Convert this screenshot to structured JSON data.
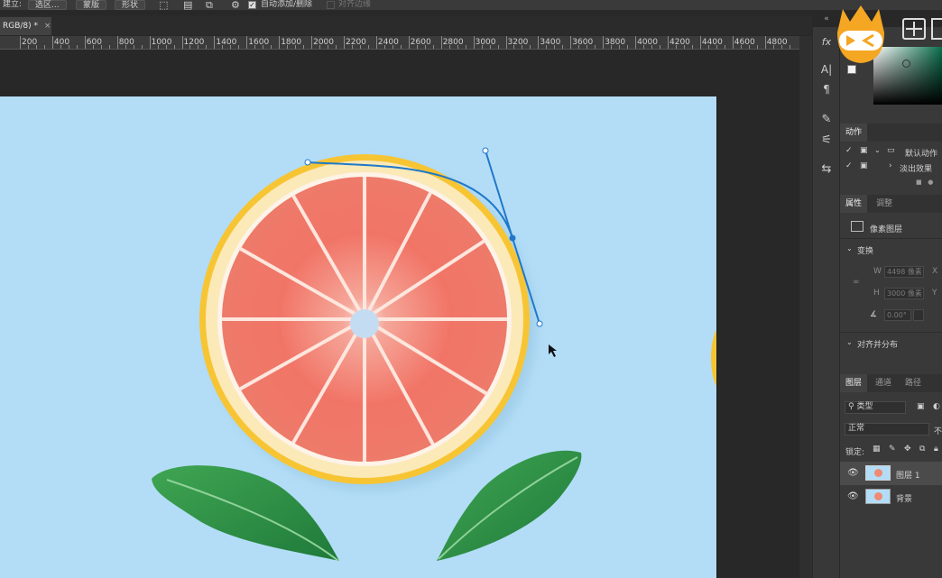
{
  "options_bar": {
    "create_label": "建立:",
    "selection_btn": "选区...",
    "mask_btn": "蒙版",
    "shape_btn": "形状",
    "auto_add_delete": "自动添加/删除",
    "align_edges": "对齐边缘"
  },
  "document": {
    "tab_title": "RGB/8) *",
    "close_glyph": "×"
  },
  "ruler": {
    "labels": [
      "200",
      "400",
      "600",
      "800",
      "1000",
      "1200",
      "1400",
      "1600",
      "1800",
      "2000",
      "2200",
      "2400",
      "2600",
      "2800",
      "3000",
      "3200",
      "3400",
      "3600",
      "3800",
      "4000",
      "4200",
      "4400",
      "4600",
      "4800"
    ]
  },
  "toolstrip": {
    "collapse_glyph": "«",
    "fx": "fx",
    "char": "A|",
    "para": "¶"
  },
  "actions_panel": {
    "tab_label": "动作",
    "items": [
      {
        "label": "默认动作",
        "checked": true
      },
      {
        "label": "淡出效果",
        "checked": true
      }
    ]
  },
  "properties_panel": {
    "tab_properties": "属性",
    "tab_adjust": "调整",
    "layer_type": "像素图层",
    "transform_title": "变换",
    "w_label": "W",
    "w_value": "4498 像素",
    "x_label": "X",
    "h_label": "H",
    "h_value": "3000 像素",
    "y_label": "Y",
    "angle_value": "0.00°",
    "align_title": "对齐并分布"
  },
  "layers_panel": {
    "tab_layers": "图层",
    "tab_channels": "通道",
    "tab_paths": "路径",
    "filter_label": "类型",
    "blend_mode": "正常",
    "opacity_prefix": "不",
    "lock_label": "锁定:",
    "layers": [
      {
        "name": "图层 1",
        "selected": true
      },
      {
        "name": "背景",
        "selected": false
      }
    ]
  },
  "colors": {
    "canvas_bg": "#b3ddf7",
    "path_stroke": "#1f78c8",
    "logo_orange": "#f5a623"
  }
}
